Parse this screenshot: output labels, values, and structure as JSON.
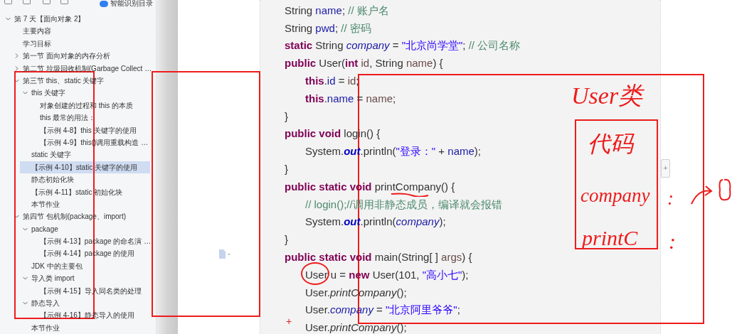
{
  "sidebar": {
    "toolbar": {
      "toggle": {
        "label": "智能识别目录",
        "on": true
      }
    },
    "tree": [
      {
        "label": "第 7 天【面向对象 2】",
        "expanded": true,
        "selected": false,
        "children": [
          {
            "label": "主要内容",
            "selected": false
          },
          {
            "label": "学习目标",
            "selected": false
          },
          {
            "label": "第一节 面向对象的内存分析",
            "expanded": false,
            "selected": false
          },
          {
            "label": "第二节 垃圾回收机制(Garbage Collect …",
            "expanded": false,
            "selected": false
          },
          {
            "label": "第三节 this、static 关键字",
            "expanded": true,
            "selected": false,
            "children": [
              {
                "label": "this 关键字",
                "expanded": true,
                "selected": false,
                "children": [
                  {
                    "label": "对象创建的过程和 this 的本质",
                    "selected": false
                  },
                  {
                    "label": "this 最常的用法：",
                    "selected": false
                  },
                  {
                    "label": "【示例 4-8】this 关键字的使用",
                    "selected": false
                  },
                  {
                    "label": "【示例 4-9】this()调用重载构造 …",
                    "selected": false
                  }
                ]
              },
              {
                "label": "static 关键字",
                "selected": false
              },
              {
                "label": "【示例 4-10】static 关键字的使用",
                "selected": true
              },
              {
                "label": "静态初始化块",
                "selected": false
              },
              {
                "label": "【示例 4-11】static 初始化块",
                "selected": false
              },
              {
                "label": "本节作业",
                "selected": false
              }
            ]
          },
          {
            "label": "第四节 包机制(package、import)",
            "expanded": true,
            "selected": false,
            "children": [
              {
                "label": "package",
                "expanded": true,
                "selected": false,
                "children": [
                  {
                    "label": "【示例 4-13】package 的命名演 …",
                    "selected": false
                  },
                  {
                    "label": "【示例 4-14】package 的使用",
                    "selected": false
                  }
                ]
              },
              {
                "label": "JDK 中的主要包",
                "selected": false
              },
              {
                "label": "导入类 import",
                "expanded": true,
                "selected": false,
                "children": [
                  {
                    "label": "【示例 4-15】导入同名类的处理",
                    "selected": false
                  }
                ]
              },
              {
                "label": "静态导入",
                "expanded": true,
                "selected": false,
                "children": [
                  {
                    "label": "【示例 4-16】静态导入的使用",
                    "selected": false
                  }
                ]
              },
              {
                "label": "本节作业",
                "selected": false
              }
            ]
          }
        ]
      }
    ]
  },
  "code": {
    "lines": [
      {
        "indented": false,
        "tokens": [
          {
            "text": "String ",
            "kind": "id"
          },
          {
            "text": "name",
            "kind": "var"
          },
          {
            "text": "; ",
            "kind": "id"
          },
          {
            "text": "// 账户名",
            "kind": "cm"
          }
        ]
      },
      {
        "indented": false,
        "tokens": [
          {
            "text": "String ",
            "kind": "id"
          },
          {
            "text": "pwd",
            "kind": "var"
          },
          {
            "text": "; ",
            "kind": "id"
          },
          {
            "text": "// 密码",
            "kind": "cm"
          }
        ]
      },
      {
        "indented": false,
        "tokens": [
          {
            "text": "static ",
            "kind": "kw"
          },
          {
            "text": "String ",
            "kind": "id"
          },
          {
            "text": "company",
            "kind": "sfield"
          },
          {
            "text": " = ",
            "kind": "id"
          },
          {
            "text": "\"北京尚学堂\"",
            "kind": "str"
          },
          {
            "text": "; ",
            "kind": "id"
          },
          {
            "text": "// 公司名称",
            "kind": "cm"
          }
        ]
      },
      {
        "indented": false,
        "tokens": [
          {
            "text": "public ",
            "kind": "kw"
          },
          {
            "text": "User(",
            "kind": "id"
          },
          {
            "text": "int ",
            "kind": "kw"
          },
          {
            "text": "id",
            "kind": "param"
          },
          {
            "text": ", String ",
            "kind": "id"
          },
          {
            "text": "name",
            "kind": "param"
          },
          {
            "text": ") {",
            "kind": "id"
          }
        ]
      },
      {
        "indented": true,
        "tokens": [
          {
            "text": "this",
            "kind": "kw"
          },
          {
            "text": ".",
            "kind": "id"
          },
          {
            "text": "id",
            "kind": "var"
          },
          {
            "text": " = ",
            "kind": "id"
          },
          {
            "text": "id",
            "kind": "param"
          },
          {
            "text": ";",
            "kind": "id"
          }
        ]
      },
      {
        "indented": true,
        "tokens": [
          {
            "text": "this",
            "kind": "kw"
          },
          {
            "text": ".",
            "kind": "id"
          },
          {
            "text": "name",
            "kind": "var"
          },
          {
            "text": " = ",
            "kind": "id"
          },
          {
            "text": "name",
            "kind": "param"
          },
          {
            "text": ";",
            "kind": "id"
          }
        ]
      },
      {
        "indented": false,
        "tokens": [
          {
            "text": "}",
            "kind": "id"
          }
        ]
      },
      {
        "indented": false,
        "tokens": [
          {
            "text": "public void ",
            "kind": "kw"
          },
          {
            "text": "login() {",
            "kind": "id"
          }
        ]
      },
      {
        "indented": true,
        "tokens": [
          {
            "text": "System.",
            "kind": "id"
          },
          {
            "text": "out",
            "kind": "out"
          },
          {
            "text": ".println(",
            "kind": "id"
          },
          {
            "text": "\"登录：\"",
            "kind": "str"
          },
          {
            "text": " + ",
            "kind": "id"
          },
          {
            "text": "name",
            "kind": "var"
          },
          {
            "text": ");",
            "kind": "id"
          }
        ]
      },
      {
        "indented": false,
        "tokens": [
          {
            "text": "}",
            "kind": "id"
          }
        ]
      },
      {
        "indented": false,
        "tokens": [
          {
            "text": "public static void ",
            "kind": "kw"
          },
          {
            "text": "printCompany() {",
            "kind": "id"
          }
        ]
      },
      {
        "indented": true,
        "tokens": [
          {
            "text": "// login();//调用非静态成员，编译就会报错",
            "kind": "cm"
          }
        ]
      },
      {
        "indented": true,
        "tokens": [
          {
            "text": "System.",
            "kind": "id"
          },
          {
            "text": "out",
            "kind": "out"
          },
          {
            "text": ".println(",
            "kind": "id"
          },
          {
            "text": "company",
            "kind": "sfield"
          },
          {
            "text": ");",
            "kind": "id"
          }
        ]
      },
      {
        "indented": false,
        "tokens": [
          {
            "text": "}",
            "kind": "id"
          }
        ]
      },
      {
        "indented": false,
        "tokens": [
          {
            "text": "public static void ",
            "kind": "kw"
          },
          {
            "text": "main(String[ ] ",
            "kind": "id"
          },
          {
            "text": "args",
            "kind": "param"
          },
          {
            "text": ") {",
            "kind": "id"
          }
        ]
      },
      {
        "indented": true,
        "tokens": [
          {
            "text": "User u = ",
            "kind": "id"
          },
          {
            "text": "new ",
            "kind": "kw"
          },
          {
            "text": "User(101, ",
            "kind": "id"
          },
          {
            "text": "\"高小七\"",
            "kind": "str"
          },
          {
            "text": ");",
            "kind": "id"
          }
        ]
      },
      {
        "indented": true,
        "tokens": [
          {
            "text": "User.",
            "kind": "id"
          },
          {
            "text": "printCompany",
            "kind": "smethod"
          },
          {
            "text": "();",
            "kind": "id"
          }
        ]
      },
      {
        "indented": true,
        "tokens": [
          {
            "text": "User.",
            "kind": "id"
          },
          {
            "text": "company",
            "kind": "sfield"
          },
          {
            "text": " = ",
            "kind": "id"
          },
          {
            "text": "\"北京阿里爷爷\"",
            "kind": "str"
          },
          {
            "text": ";",
            "kind": "id"
          }
        ]
      },
      {
        "indented": true,
        "marker": "+",
        "tokens": [
          {
            "text": "User.",
            "kind": "id"
          },
          {
            "text": "printCompany",
            "kind": "smethod"
          },
          {
            "text": "();",
            "kind": "id"
          }
        ]
      }
    ]
  },
  "side_panel": {
    "add_button": "+"
  },
  "annotations": [
    {
      "kind": "box"
    },
    {
      "kind": "box"
    },
    {
      "kind": "box"
    },
    {
      "kind": "box"
    },
    {
      "kind": "circle"
    },
    {
      "kind": "underline"
    },
    {
      "kind": "note",
      "text": "User类"
    },
    {
      "kind": "note",
      "text": "代码"
    },
    {
      "kind": "note",
      "text": "company"
    },
    {
      "kind": "note",
      "text": ":"
    },
    {
      "kind": "note",
      "text": "printC"
    },
    {
      "kind": "note",
      "text": ":"
    },
    {
      "kind": "arrow"
    }
  ]
}
